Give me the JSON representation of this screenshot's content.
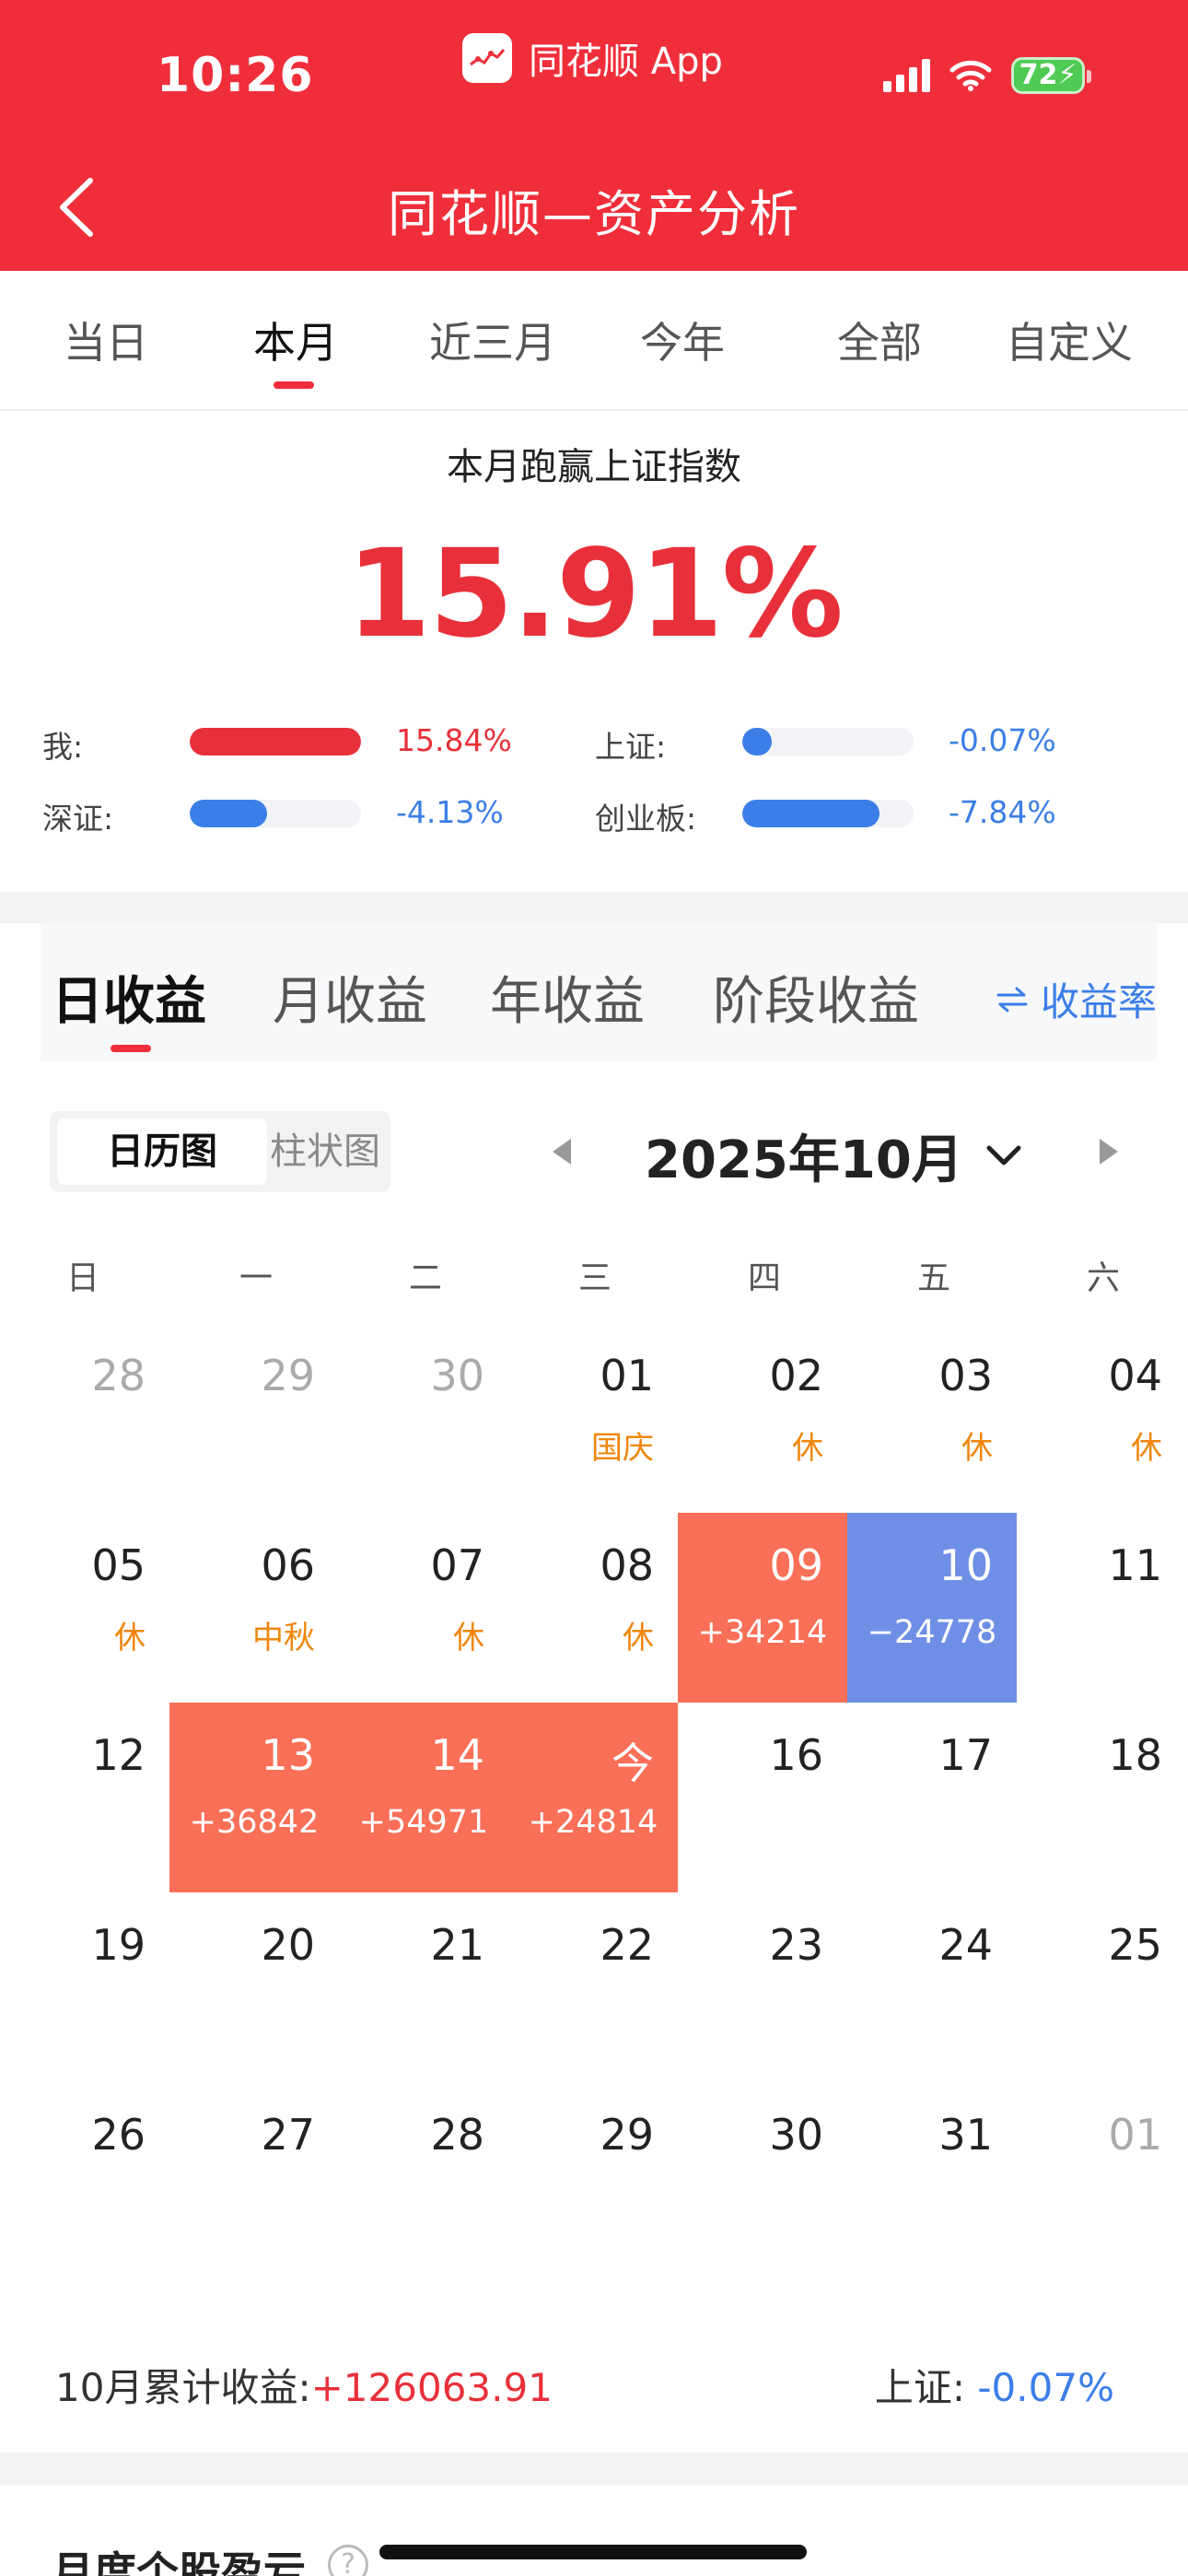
{
  "status_bar": {
    "time": "10:26",
    "app_name": "同花顺 App",
    "battery": "72"
  },
  "nav": {
    "title": "同花顺—资产分析"
  },
  "range_tabs": [
    "当日",
    "本月",
    "近三月",
    "今年",
    "全部",
    "自定义"
  ],
  "range_active": "本月",
  "summary": {
    "title": "本月跑赢上证指数",
    "value": "15.91%",
    "comparisons": [
      {
        "label": "我:",
        "value": "15.84%",
        "fill_fraction": 1.0,
        "color": "#e8303a"
      },
      {
        "label": "上证:",
        "value": "-0.07%",
        "fill_fraction": 0.17,
        "color": "#3b7ee8"
      },
      {
        "label": "深证:",
        "value": "-4.13%",
        "fill_fraction": 0.45,
        "color": "#3b7ee8"
      },
      {
        "label": "创业板:",
        "value": "-7.84%",
        "fill_fraction": 0.8,
        "color": "#3b7ee8"
      }
    ]
  },
  "earnings": {
    "tabs": [
      "日收益",
      "月收益",
      "年收益",
      "阶段收益"
    ],
    "active_tab": "日收益",
    "rate_toggle": "收益率",
    "view_options": [
      "日历图",
      "柱状图"
    ],
    "view_active": "日历图",
    "month_title": "2025年10月",
    "weekdays": [
      "日",
      "一",
      "二",
      "三",
      "四",
      "五",
      "六"
    ],
    "weeks": [
      [
        {
          "day": "28",
          "muted": true
        },
        {
          "day": "29",
          "muted": true
        },
        {
          "day": "30",
          "muted": true
        },
        {
          "day": "01",
          "note": "国庆"
        },
        {
          "day": "02",
          "note": "休"
        },
        {
          "day": "03",
          "note": "休"
        },
        {
          "day": "04",
          "note": "休"
        }
      ],
      [
        {
          "day": "05",
          "note": "休"
        },
        {
          "day": "06",
          "note": "中秋"
        },
        {
          "day": "07",
          "note": "休"
        },
        {
          "day": "08",
          "note": "休"
        },
        {
          "day": "09",
          "pnl": "+34214",
          "trend": "up"
        },
        {
          "day": "10",
          "pnl": "−24778",
          "trend": "down"
        },
        {
          "day": "11"
        }
      ],
      [
        {
          "day": "12"
        },
        {
          "day": "13",
          "pnl": "+36842",
          "trend": "up"
        },
        {
          "day": "14",
          "pnl": "+54971",
          "trend": "up"
        },
        {
          "day": "今",
          "pnl": "+24814",
          "trend": "up"
        },
        {
          "day": "16"
        },
        {
          "day": "17"
        },
        {
          "day": "18"
        }
      ],
      [
        {
          "day": "19"
        },
        {
          "day": "20"
        },
        {
          "day": "21"
        },
        {
          "day": "22"
        },
        {
          "day": "23"
        },
        {
          "day": "24"
        },
        {
          "day": "25"
        }
      ],
      [
        {
          "day": "26"
        },
        {
          "day": "27"
        },
        {
          "day": "28"
        },
        {
          "day": "29"
        },
        {
          "day": "30"
        },
        {
          "day": "31"
        },
        {
          "day": "01",
          "muted": true
        }
      ]
    ],
    "footer": {
      "cumulative_label": "10月累计收益:",
      "cumulative_value": "+126063.91",
      "index_label": "上证:",
      "index_value": "-0.07%"
    }
  },
  "bottom_section": {
    "title": "月度个股盈亏",
    "help": "?"
  },
  "colors": {
    "brand_red": "#ef2e3a",
    "gain": "#f96f57",
    "loss": "#6f8fe6",
    "holiday": "#f0860d",
    "link_blue": "#3b7ee8"
  }
}
